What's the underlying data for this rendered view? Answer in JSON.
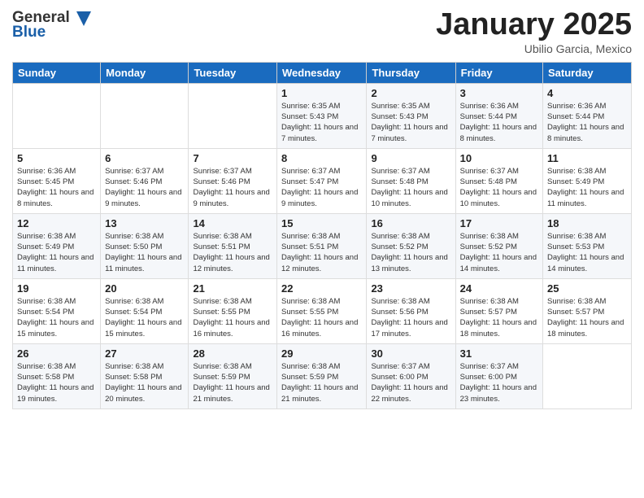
{
  "header": {
    "logo": {
      "general": "General",
      "blue": "Blue"
    },
    "title": "January 2025",
    "subtitle": "Ubilio Garcia, Mexico"
  },
  "weekdays": [
    "Sunday",
    "Monday",
    "Tuesday",
    "Wednesday",
    "Thursday",
    "Friday",
    "Saturday"
  ],
  "weeks": [
    [
      {
        "day": "",
        "sunrise": "",
        "sunset": "",
        "daylight": ""
      },
      {
        "day": "",
        "sunrise": "",
        "sunset": "",
        "daylight": ""
      },
      {
        "day": "",
        "sunrise": "",
        "sunset": "",
        "daylight": ""
      },
      {
        "day": "1",
        "sunrise": "Sunrise: 6:35 AM",
        "sunset": "Sunset: 5:43 PM",
        "daylight": "Daylight: 11 hours and 7 minutes."
      },
      {
        "day": "2",
        "sunrise": "Sunrise: 6:35 AM",
        "sunset": "Sunset: 5:43 PM",
        "daylight": "Daylight: 11 hours and 7 minutes."
      },
      {
        "day": "3",
        "sunrise": "Sunrise: 6:36 AM",
        "sunset": "Sunset: 5:44 PM",
        "daylight": "Daylight: 11 hours and 8 minutes."
      },
      {
        "day": "4",
        "sunrise": "Sunrise: 6:36 AM",
        "sunset": "Sunset: 5:44 PM",
        "daylight": "Daylight: 11 hours and 8 minutes."
      }
    ],
    [
      {
        "day": "5",
        "sunrise": "Sunrise: 6:36 AM",
        "sunset": "Sunset: 5:45 PM",
        "daylight": "Daylight: 11 hours and 8 minutes."
      },
      {
        "day": "6",
        "sunrise": "Sunrise: 6:37 AM",
        "sunset": "Sunset: 5:46 PM",
        "daylight": "Daylight: 11 hours and 9 minutes."
      },
      {
        "day": "7",
        "sunrise": "Sunrise: 6:37 AM",
        "sunset": "Sunset: 5:46 PM",
        "daylight": "Daylight: 11 hours and 9 minutes."
      },
      {
        "day": "8",
        "sunrise": "Sunrise: 6:37 AM",
        "sunset": "Sunset: 5:47 PM",
        "daylight": "Daylight: 11 hours and 9 minutes."
      },
      {
        "day": "9",
        "sunrise": "Sunrise: 6:37 AM",
        "sunset": "Sunset: 5:48 PM",
        "daylight": "Daylight: 11 hours and 10 minutes."
      },
      {
        "day": "10",
        "sunrise": "Sunrise: 6:37 AM",
        "sunset": "Sunset: 5:48 PM",
        "daylight": "Daylight: 11 hours and 10 minutes."
      },
      {
        "day": "11",
        "sunrise": "Sunrise: 6:38 AM",
        "sunset": "Sunset: 5:49 PM",
        "daylight": "Daylight: 11 hours and 11 minutes."
      }
    ],
    [
      {
        "day": "12",
        "sunrise": "Sunrise: 6:38 AM",
        "sunset": "Sunset: 5:49 PM",
        "daylight": "Daylight: 11 hours and 11 minutes."
      },
      {
        "day": "13",
        "sunrise": "Sunrise: 6:38 AM",
        "sunset": "Sunset: 5:50 PM",
        "daylight": "Daylight: 11 hours and 11 minutes."
      },
      {
        "day": "14",
        "sunrise": "Sunrise: 6:38 AM",
        "sunset": "Sunset: 5:51 PM",
        "daylight": "Daylight: 11 hours and 12 minutes."
      },
      {
        "day": "15",
        "sunrise": "Sunrise: 6:38 AM",
        "sunset": "Sunset: 5:51 PM",
        "daylight": "Daylight: 11 hours and 12 minutes."
      },
      {
        "day": "16",
        "sunrise": "Sunrise: 6:38 AM",
        "sunset": "Sunset: 5:52 PM",
        "daylight": "Daylight: 11 hours and 13 minutes."
      },
      {
        "day": "17",
        "sunrise": "Sunrise: 6:38 AM",
        "sunset": "Sunset: 5:52 PM",
        "daylight": "Daylight: 11 hours and 14 minutes."
      },
      {
        "day": "18",
        "sunrise": "Sunrise: 6:38 AM",
        "sunset": "Sunset: 5:53 PM",
        "daylight": "Daylight: 11 hours and 14 minutes."
      }
    ],
    [
      {
        "day": "19",
        "sunrise": "Sunrise: 6:38 AM",
        "sunset": "Sunset: 5:54 PM",
        "daylight": "Daylight: 11 hours and 15 minutes."
      },
      {
        "day": "20",
        "sunrise": "Sunrise: 6:38 AM",
        "sunset": "Sunset: 5:54 PM",
        "daylight": "Daylight: 11 hours and 15 minutes."
      },
      {
        "day": "21",
        "sunrise": "Sunrise: 6:38 AM",
        "sunset": "Sunset: 5:55 PM",
        "daylight": "Daylight: 11 hours and 16 minutes."
      },
      {
        "day": "22",
        "sunrise": "Sunrise: 6:38 AM",
        "sunset": "Sunset: 5:55 PM",
        "daylight": "Daylight: 11 hours and 16 minutes."
      },
      {
        "day": "23",
        "sunrise": "Sunrise: 6:38 AM",
        "sunset": "Sunset: 5:56 PM",
        "daylight": "Daylight: 11 hours and 17 minutes."
      },
      {
        "day": "24",
        "sunrise": "Sunrise: 6:38 AM",
        "sunset": "Sunset: 5:57 PM",
        "daylight": "Daylight: 11 hours and 18 minutes."
      },
      {
        "day": "25",
        "sunrise": "Sunrise: 6:38 AM",
        "sunset": "Sunset: 5:57 PM",
        "daylight": "Daylight: 11 hours and 18 minutes."
      }
    ],
    [
      {
        "day": "26",
        "sunrise": "Sunrise: 6:38 AM",
        "sunset": "Sunset: 5:58 PM",
        "daylight": "Daylight: 11 hours and 19 minutes."
      },
      {
        "day": "27",
        "sunrise": "Sunrise: 6:38 AM",
        "sunset": "Sunset: 5:58 PM",
        "daylight": "Daylight: 11 hours and 20 minutes."
      },
      {
        "day": "28",
        "sunrise": "Sunrise: 6:38 AM",
        "sunset": "Sunset: 5:59 PM",
        "daylight": "Daylight: 11 hours and 21 minutes."
      },
      {
        "day": "29",
        "sunrise": "Sunrise: 6:38 AM",
        "sunset": "Sunset: 5:59 PM",
        "daylight": "Daylight: 11 hours and 21 minutes."
      },
      {
        "day": "30",
        "sunrise": "Sunrise: 6:37 AM",
        "sunset": "Sunset: 6:00 PM",
        "daylight": "Daylight: 11 hours and 22 minutes."
      },
      {
        "day": "31",
        "sunrise": "Sunrise: 6:37 AM",
        "sunset": "Sunset: 6:00 PM",
        "daylight": "Daylight: 11 hours and 23 minutes."
      },
      {
        "day": "",
        "sunrise": "",
        "sunset": "",
        "daylight": ""
      }
    ]
  ]
}
